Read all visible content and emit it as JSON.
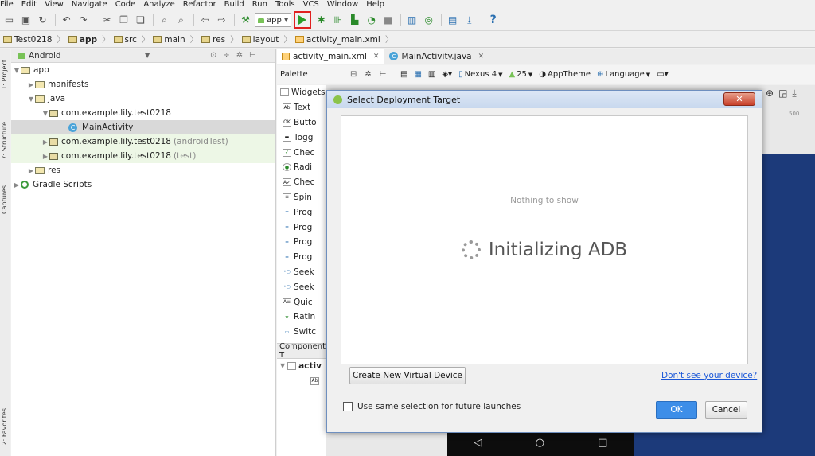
{
  "menu": [
    "File",
    "Edit",
    "View",
    "Navigate",
    "Code",
    "Analyze",
    "Refactor",
    "Build",
    "Run",
    "Tools",
    "VCS",
    "Window",
    "Help"
  ],
  "toolbar": {
    "app_config": "app",
    "help": "?"
  },
  "breadcrumb": [
    "Test0218",
    "app",
    "src",
    "main",
    "res",
    "layout",
    "activity_main.xml"
  ],
  "left_strip": {
    "project": "1: Project",
    "structure": "7: Structure",
    "captures": "Captures",
    "favorites": "2: Favorites"
  },
  "project_panel": {
    "view_mode": "Android",
    "tree": {
      "app": "app",
      "manifests": "manifests",
      "java": "java",
      "pkg_main": "com.example.lily.test0218",
      "main_activity": "MainActivity",
      "pkg_android_test": "com.example.lily.test0218",
      "android_test_suffix": "(androidTest)",
      "pkg_test": "com.example.lily.test0218",
      "test_suffix": "(test)",
      "res": "res",
      "gradle": "Gradle Scripts"
    }
  },
  "editor_tabs": [
    {
      "label": "activity_main.xml"
    },
    {
      "label": "MainActivity.java"
    }
  ],
  "design_toolbar": {
    "palette": "Palette",
    "device": "Nexus 4",
    "api": "25",
    "theme": "AppTheme",
    "language": "Language"
  },
  "palette": {
    "group": "Widgets",
    "items": [
      "Text",
      "Butto",
      "Togg",
      "Chec",
      "Radi",
      "Chec",
      "Spin",
      "Prog",
      "Prog",
      "Prog",
      "Prog",
      "Seek",
      "Seek",
      "Quic",
      "Ratin",
      "Switc"
    ],
    "component_tree": "Component T",
    "tree_root": "activ"
  },
  "ruler": {
    "mark": "500"
  },
  "dialog": {
    "title": "Select Deployment Target",
    "empty_text": "Nothing to show",
    "status": "Initializing ADB",
    "create_button": "Create New Virtual Device",
    "help_link": "Don't see your device?",
    "checkbox_label": "Use same selection for future launches",
    "ok": "OK",
    "cancel": "Cancel"
  },
  "colors": {
    "run_highlight": "#e02020",
    "ok_button": "#3d8ee8",
    "canvas_blue": "#1c3a7a"
  }
}
